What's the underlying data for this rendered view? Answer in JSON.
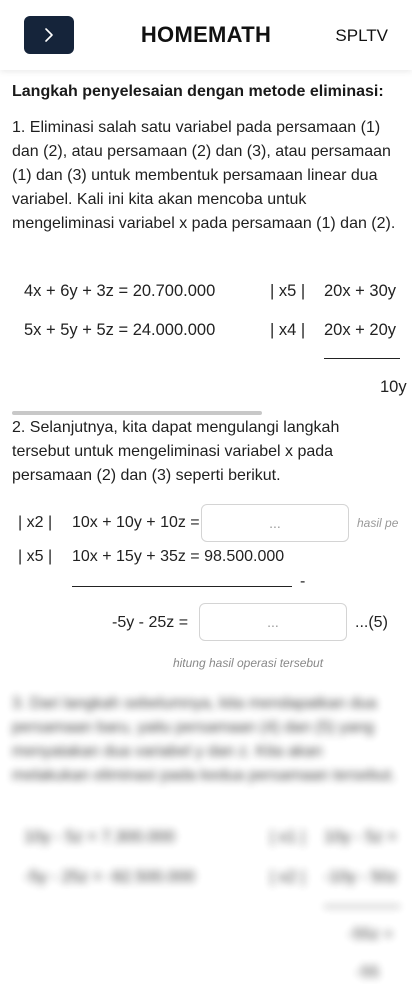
{
  "header": {
    "back_icon": "chevron-right-icon",
    "brand": "HOMEMATH",
    "topic": "SPLTV"
  },
  "section": {
    "heading": "Langkah penyelesaian dengan metode eliminasi:",
    "step1": "1. Eliminasi salah satu variabel pada persamaan (1) dan (2), atau persamaan (2) dan (3), atau persamaan (1) dan (3) untuk membentuk persamaan linear dua variabel. Kali ini kita akan mencoba untuk mengeliminasi variabel x pada persamaan (1) dan (2).",
    "eq_rows": [
      {
        "left": "4x + 6y + 3z = 20.700.000",
        "mult": "| x5 |",
        "right": "20x + 30y"
      },
      {
        "left": "5x + 5y + 5z = 24.000.000",
        "mult": "| x4 |",
        "right": "20x + 20y"
      }
    ],
    "eq_result_cut": "10y",
    "step2": "2. Selanjutnya, kita dapat mengulangi langkah tersebut untuk mengeliminasi variabel x pada persamaan (2) dan (3) seperti berikut.",
    "op_rows": [
      {
        "mult": "| x2 |",
        "expr": "10x + 10y + 10z =",
        "placeholder": "...",
        "note": "hasil pe"
      },
      {
        "mult": "| x5 |",
        "expr": "10x + 15y + 35z = 98.500.000"
      }
    ],
    "minus_sign": "-",
    "result_expr": "-5y - 25z =",
    "result_placeholder": "...",
    "result_label": "...(5)",
    "hint": "hitung hasil operasi tersebut",
    "step3": "3. Dari langkah sebelumnya, kita mendapatkan dua persamaan baru, yaitu persamaan (4) dan (5) yang menyatakan dua variabel y dan z. Kita akan melakukan eliminasi pada kedua persamaan tersebut.",
    "eq_rows_blurred": [
      {
        "left": "10y - 5z = 7.300.000",
        "mult": "| x1 |",
        "right": "10y - 5z ="
      },
      {
        "left": "-5y - 25z = -92.500.000",
        "mult": "| x2 |",
        "right": "-10y - 50z"
      }
    ],
    "blurred_results": [
      "-55z =",
      "-55"
    ]
  }
}
